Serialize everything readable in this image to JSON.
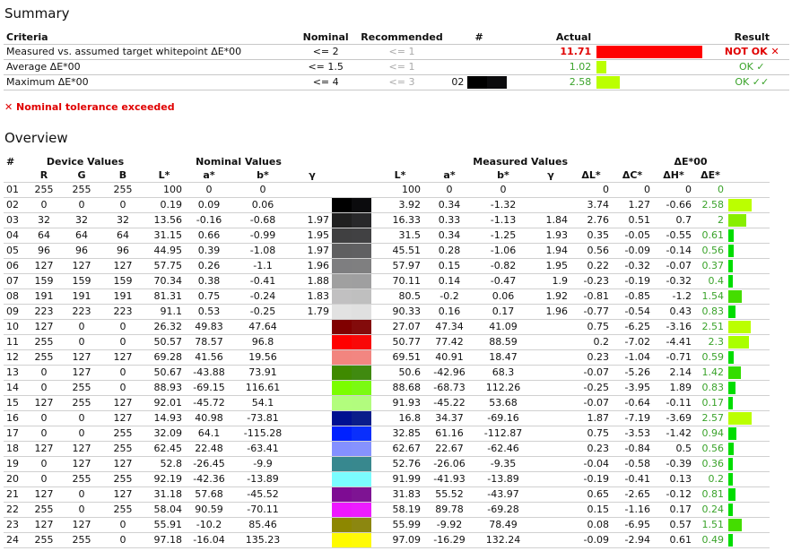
{
  "summary": {
    "title": "Summary",
    "headers": {
      "criteria": "Criteria",
      "nominal": "Nominal",
      "recommended": "Recommended",
      "num": "#",
      "actual": "Actual",
      "result": "Result"
    },
    "rows": [
      {
        "criteria": "Measured vs. assumed target whitepoint ΔE*00",
        "nominal": "<= 2",
        "recommended": "<= 1",
        "patch": "",
        "actual": "11.71",
        "bar_fraction": 1.0,
        "bar_color": "#ff0000",
        "result": "NOT OK ✕",
        "status": "fail"
      },
      {
        "criteria": "Average ΔE*00",
        "nominal": "<= 1.5",
        "recommended": "<= 1",
        "patch": "",
        "actual": "1.02",
        "bar_fraction": 0.09,
        "bar_color": "#bbff00",
        "result": "OK ✓",
        "status": "ok"
      },
      {
        "criteria": "Maximum ΔE*00",
        "nominal": "<= 4",
        "recommended": "<= 3",
        "patch": "02",
        "actual": "2.58",
        "bar_fraction": 0.22,
        "bar_color": "#bbff00",
        "result": "OK ✓✓",
        "status": "ok"
      }
    ],
    "warning": "✕ Nominal tolerance exceeded"
  },
  "overview": {
    "title": "Overview",
    "group_headers": {
      "device": "Device Values",
      "nominal": "Nominal Values",
      "measured": "Measured Values",
      "de": "ΔE*00"
    },
    "col_headers": {
      "num": "#",
      "r": "R",
      "g": "G",
      "b": "B",
      "nl": "L*",
      "na": "a*",
      "nb": "b*",
      "ng": "γ",
      "ml": "L*",
      "ma": "a*",
      "mb": "b*",
      "mg": "γ",
      "dl": "ΔL*",
      "dc": "ΔC*",
      "dh": "ΔH*",
      "de": "ΔE*"
    },
    "rows": [
      {
        "id": "01",
        "r": "255",
        "g": "255",
        "b": "255",
        "nl": "100",
        "na": "0",
        "nb": "0",
        "ng": "",
        "ml": "100",
        "ma": "0",
        "mb": "0",
        "mg": "",
        "dl": "0",
        "dc": "0",
        "dh": "0",
        "de": "0",
        "nom_color": "#ffffff",
        "meas_color": "#ffffff",
        "bar": 0,
        "bar_color": "#00dd00"
      },
      {
        "id": "02",
        "r": "0",
        "g": "0",
        "b": "0",
        "nl": "0.19",
        "na": "0.09",
        "nb": "0.06",
        "ng": "",
        "ml": "3.92",
        "ma": "0.34",
        "mb": "-1.32",
        "mg": "",
        "dl": "3.74",
        "dc": "1.27",
        "dh": "-0.66",
        "de": "2.58",
        "nom_color": "#000000",
        "meas_color": "#0b0b0d",
        "bar": 2.58,
        "bar_color": "#bbff00"
      },
      {
        "id": "03",
        "r": "32",
        "g": "32",
        "b": "32",
        "nl": "13.56",
        "na": "-0.16",
        "nb": "-0.68",
        "ng": "1.97",
        "ml": "16.33",
        "ma": "0.33",
        "mb": "-1.13",
        "mg": "1.84",
        "dl": "2.76",
        "dc": "0.51",
        "dh": "0.7",
        "de": "2",
        "nom_color": "#202020",
        "meas_color": "#28282a",
        "bar": 2,
        "bar_color": "#88ee00"
      },
      {
        "id": "04",
        "r": "64",
        "g": "64",
        "b": "64",
        "nl": "31.15",
        "na": "0.66",
        "nb": "-0.99",
        "ng": "1.95",
        "ml": "31.5",
        "ma": "0.34",
        "mb": "-1.25",
        "mg": "1.93",
        "dl": "0.35",
        "dc": "-0.05",
        "dh": "-0.55",
        "de": "0.61",
        "nom_color": "#404041",
        "meas_color": "#414143",
        "bar": 0.61,
        "bar_color": "#00dd00"
      },
      {
        "id": "05",
        "r": "96",
        "g": "96",
        "b": "96",
        "nl": "44.95",
        "na": "0.39",
        "nb": "-1.08",
        "ng": "1.97",
        "ml": "45.51",
        "ma": "0.28",
        "mb": "-1.06",
        "mg": "1.94",
        "dl": "0.56",
        "dc": "-0.09",
        "dh": "-0.14",
        "de": "0.56",
        "nom_color": "#5f5f60",
        "meas_color": "#606062",
        "bar": 0.56,
        "bar_color": "#00dd00"
      },
      {
        "id": "06",
        "r": "127",
        "g": "127",
        "b": "127",
        "nl": "57.75",
        "na": "0.26",
        "nb": "-1.1",
        "ng": "1.96",
        "ml": "57.97",
        "ma": "0.15",
        "mb": "-0.82",
        "mg": "1.95",
        "dl": "0.22",
        "dc": "-0.32",
        "dh": "-0.07",
        "de": "0.37",
        "nom_color": "#7e7e80",
        "meas_color": "#7f7f80",
        "bar": 0.37,
        "bar_color": "#00dd00"
      },
      {
        "id": "07",
        "r": "159",
        "g": "159",
        "b": "159",
        "nl": "70.34",
        "na": "0.38",
        "nb": "-0.41",
        "ng": "1.88",
        "ml": "70.11",
        "ma": "0.14",
        "mb": "-0.47",
        "mg": "1.9",
        "dl": "-0.23",
        "dc": "-0.19",
        "dh": "-0.32",
        "de": "0.4",
        "nom_color": "#a0a0a0",
        "meas_color": "#9f9fa0",
        "bar": 0.4,
        "bar_color": "#00dd00"
      },
      {
        "id": "08",
        "r": "191",
        "g": "191",
        "b": "191",
        "nl": "81.31",
        "na": "0.75",
        "nb": "-0.24",
        "ng": "1.83",
        "ml": "80.5",
        "ma": "-0.2",
        "mb": "0.06",
        "mg": "1.92",
        "dl": "-0.81",
        "dc": "-0.85",
        "dh": "-1.2",
        "de": "1.54",
        "nom_color": "#c1c0c1",
        "meas_color": "#bfbfbf",
        "bar": 1.54,
        "bar_color": "#44dd00"
      },
      {
        "id": "09",
        "r": "223",
        "g": "223",
        "b": "223",
        "nl": "91.1",
        "na": "0.53",
        "nb": "-0.25",
        "ng": "1.79",
        "ml": "90.33",
        "ma": "0.16",
        "mb": "0.17",
        "mg": "1.96",
        "dl": "-0.77",
        "dc": "-0.54",
        "dh": "0.43",
        "de": "0.83",
        "nom_color": "#e2e2e2",
        "meas_color": "#e0e0e0",
        "bar": 0.83,
        "bar_color": "#00dd00"
      },
      {
        "id": "10",
        "r": "127",
        "g": "0",
        "b": "0",
        "nl": "26.32",
        "na": "49.83",
        "nb": "47.64",
        "ng": "",
        "ml": "27.07",
        "ma": "47.34",
        "mb": "41.09",
        "mg": "",
        "dl": "0.75",
        "dc": "-6.25",
        "dh": "-3.16",
        "de": "2.51",
        "nom_color": "#800000",
        "meas_color": "#830b0b",
        "bar": 2.51,
        "bar_color": "#bbff00"
      },
      {
        "id": "11",
        "r": "255",
        "g": "0",
        "b": "0",
        "nl": "50.57",
        "na": "78.57",
        "nb": "96.8",
        "ng": "",
        "ml": "50.77",
        "ma": "77.42",
        "mb": "88.59",
        "mg": "",
        "dl": "0.2",
        "dc": "-7.02",
        "dh": "-4.41",
        "de": "2.3",
        "nom_color": "#ff0000",
        "meas_color": "#f90808",
        "bar": 2.3,
        "bar_color": "#aaff00"
      },
      {
        "id": "12",
        "r": "255",
        "g": "127",
        "b": "127",
        "nl": "69.28",
        "na": "41.56",
        "nb": "19.56",
        "ng": "",
        "ml": "69.51",
        "ma": "40.91",
        "mb": "18.47",
        "mg": "",
        "dl": "0.23",
        "dc": "-1.04",
        "dh": "-0.71",
        "de": "0.59",
        "nom_color": "#f2857f",
        "meas_color": "#f28681",
        "bar": 0.59,
        "bar_color": "#00dd00"
      },
      {
        "id": "13",
        "r": "0",
        "g": "127",
        "b": "0",
        "nl": "50.67",
        "na": "-43.88",
        "nb": "73.91",
        "ng": "",
        "ml": "50.6",
        "ma": "-42.96",
        "mb": "68.3",
        "mg": "",
        "dl": "-0.07",
        "dc": "-5.26",
        "dh": "2.14",
        "de": "1.42",
        "nom_color": "#3f8a00",
        "meas_color": "#408a10",
        "bar": 1.42,
        "bar_color": "#33dd00"
      },
      {
        "id": "14",
        "r": "0",
        "g": "255",
        "b": "0",
        "nl": "88.93",
        "na": "-69.15",
        "nb": "116.61",
        "ng": "",
        "ml": "88.68",
        "ma": "-68.73",
        "mb": "112.26",
        "mg": "",
        "dl": "-0.25",
        "dc": "-3.95",
        "dh": "1.89",
        "de": "0.83",
        "nom_color": "#7bfd00",
        "meas_color": "#7bfa12",
        "bar": 0.83,
        "bar_color": "#00dd00"
      },
      {
        "id": "15",
        "r": "127",
        "g": "255",
        "b": "127",
        "nl": "92.01",
        "na": "-45.72",
        "nb": "54.1",
        "ng": "",
        "ml": "91.93",
        "ma": "-45.22",
        "mb": "53.68",
        "mg": "",
        "dl": "-0.07",
        "dc": "-0.64",
        "dh": "-0.11",
        "de": "0.17",
        "nom_color": "#b2fd7d",
        "meas_color": "#b2fc7e",
        "bar": 0.17,
        "bar_color": "#00dd00"
      },
      {
        "id": "16",
        "r": "0",
        "g": "0",
        "b": "127",
        "nl": "14.93",
        "na": "40.98",
        "nb": "-73.81",
        "ng": "",
        "ml": "16.8",
        "ma": "34.37",
        "mb": "-69.16",
        "mg": "",
        "dl": "1.87",
        "dc": "-7.19",
        "dh": "-3.69",
        "de": "2.57",
        "nom_color": "#001090",
        "meas_color": "#0a1d8a",
        "bar": 2.57,
        "bar_color": "#bbff00"
      },
      {
        "id": "17",
        "r": "0",
        "g": "0",
        "b": "255",
        "nl": "32.09",
        "na": "64.1",
        "nb": "-115.28",
        "ng": "",
        "ml": "32.85",
        "ma": "61.16",
        "mb": "-112.87",
        "mg": "",
        "dl": "0.75",
        "dc": "-3.53",
        "dh": "-1.42",
        "de": "0.94",
        "nom_color": "#0021ff",
        "meas_color": "#0a2ffc",
        "bar": 0.94,
        "bar_color": "#00dd00"
      },
      {
        "id": "18",
        "r": "127",
        "g": "127",
        "b": "255",
        "nl": "62.45",
        "na": "22.48",
        "nb": "-63.41",
        "ng": "",
        "ml": "62.67",
        "ma": "22.67",
        "mb": "-62.46",
        "mg": "",
        "dl": "0.23",
        "dc": "-0.84",
        "dh": "0.5",
        "de": "0.56",
        "nom_color": "#8490ff",
        "meas_color": "#8692fe",
        "bar": 0.56,
        "bar_color": "#00dd00"
      },
      {
        "id": "19",
        "r": "0",
        "g": "127",
        "b": "127",
        "nl": "52.8",
        "na": "-26.45",
        "nb": "-9.9",
        "ng": "",
        "ml": "52.76",
        "ma": "-26.06",
        "mb": "-9.35",
        "mg": "",
        "dl": "-0.04",
        "dc": "-0.58",
        "dh": "-0.39",
        "de": "0.36",
        "nom_color": "#37888f",
        "meas_color": "#38888e",
        "bar": 0.36,
        "bar_color": "#00dd00"
      },
      {
        "id": "20",
        "r": "0",
        "g": "255",
        "b": "255",
        "nl": "92.19",
        "na": "-42.36",
        "nb": "-13.89",
        "ng": "",
        "ml": "91.99",
        "ma": "-41.93",
        "mb": "-13.89",
        "mg": "",
        "dl": "-0.19",
        "dc": "-0.41",
        "dh": "0.13",
        "de": "0.2",
        "nom_color": "#7afdff",
        "meas_color": "#7bfcfe",
        "bar": 0.2,
        "bar_color": "#00dd00"
      },
      {
        "id": "21",
        "r": "127",
        "g": "0",
        "b": "127",
        "nl": "31.18",
        "na": "57.68",
        "nb": "-45.52",
        "ng": "",
        "ml": "31.83",
        "ma": "55.52",
        "mb": "-43.97",
        "mg": "",
        "dl": "0.65",
        "dc": "-2.65",
        "dh": "-0.12",
        "de": "0.81",
        "nom_color": "#7e0c93",
        "meas_color": "#7e1493",
        "bar": 0.81,
        "bar_color": "#00dd00"
      },
      {
        "id": "22",
        "r": "255",
        "g": "0",
        "b": "255",
        "nl": "58.04",
        "na": "90.59",
        "nb": "-70.11",
        "ng": "",
        "ml": "58.19",
        "ma": "89.78",
        "mb": "-69.28",
        "mg": "",
        "dl": "0.15",
        "dc": "-1.16",
        "dh": "0.17",
        "de": "0.24",
        "nom_color": "#ee17ff",
        "meas_color": "#ed1cfe",
        "bar": 0.24,
        "bar_color": "#00dd00"
      },
      {
        "id": "23",
        "r": "127",
        "g": "127",
        "b": "0",
        "nl": "55.91",
        "na": "-10.2",
        "nb": "85.46",
        "ng": "",
        "ml": "55.99",
        "ma": "-9.92",
        "mb": "78.49",
        "mg": "",
        "dl": "0.08",
        "dc": "-6.95",
        "dh": "0.57",
        "de": "1.51",
        "nom_color": "#8d8700",
        "meas_color": "#8c8710",
        "bar": 1.51,
        "bar_color": "#44dd00"
      },
      {
        "id": "24",
        "r": "255",
        "g": "255",
        "b": "0",
        "nl": "97.18",
        "na": "-16.04",
        "nb": "135.23",
        "ng": "",
        "ml": "97.09",
        "ma": "-16.29",
        "mb": "132.24",
        "mg": "",
        "dl": "-0.09",
        "dc": "-2.94",
        "dh": "0.61",
        "de": "0.49",
        "nom_color": "#fffb00",
        "meas_color": "#fffa08",
        "bar": 0.49,
        "bar_color": "#00dd00"
      }
    ]
  }
}
